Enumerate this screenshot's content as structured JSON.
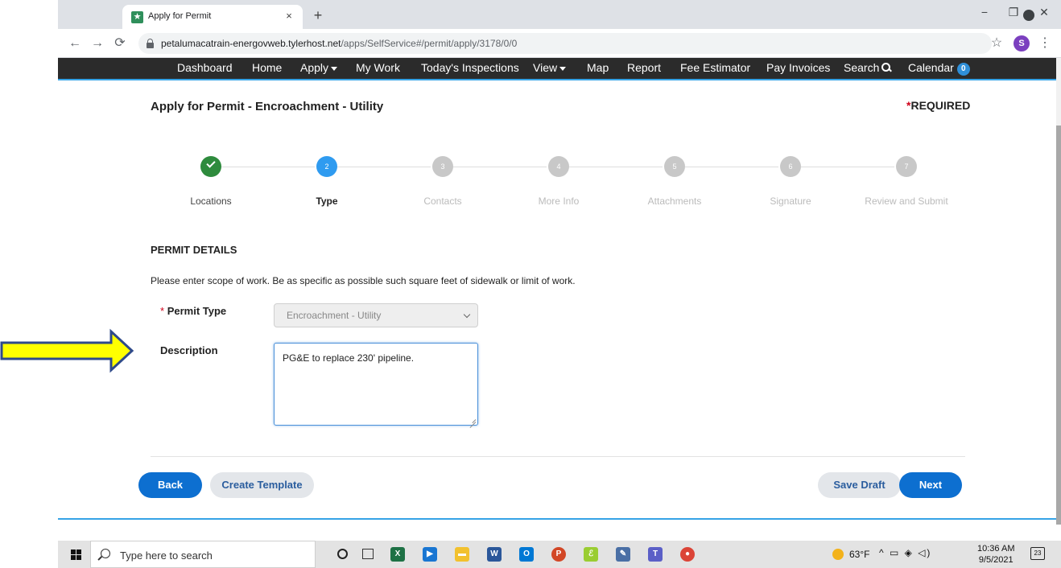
{
  "browser": {
    "tab_title": "Apply for Permit",
    "tab_close": "×",
    "new_tab": "+",
    "url_host": "petalumacatrain-energovweb.tylerhost.net",
    "url_path": "/apps/SelfService#/permit/apply/3178/0/0",
    "avatar_letter": "S",
    "window_controls": [
      "−",
      "❐",
      "✕"
    ]
  },
  "nav": {
    "items": [
      {
        "label": "Dashboard"
      },
      {
        "label": "Home"
      },
      {
        "label": "Apply",
        "dropdown": true
      },
      {
        "label": "My Work"
      },
      {
        "label": "Today's Inspections"
      },
      {
        "label": "View",
        "dropdown": true
      },
      {
        "label": "Map"
      },
      {
        "label": "Report"
      },
      {
        "label": "Fee Estimator"
      },
      {
        "label": "Pay Invoices"
      },
      {
        "label": "Search"
      },
      {
        "label": "Calendar",
        "badge": "0"
      }
    ]
  },
  "page": {
    "title": "Apply for Permit - Encroachment - Utility",
    "required_asterisk": "*",
    "required_text": "REQUIRED"
  },
  "steps": [
    {
      "number": "1",
      "label": "Locations",
      "state": "done"
    },
    {
      "number": "2",
      "label": "Type",
      "state": "active"
    },
    {
      "number": "3",
      "label": "Contacts",
      "state": "todo"
    },
    {
      "number": "4",
      "label": "More Info",
      "state": "todo"
    },
    {
      "number": "5",
      "label": "Attachments",
      "state": "todo"
    },
    {
      "number": "6",
      "label": "Signature",
      "state": "todo"
    },
    {
      "number": "7",
      "label": "Review and Submit",
      "state": "todo"
    }
  ],
  "form": {
    "section_header": "PERMIT DETAILS",
    "instructions": "Please enter scope of work. Be as specific as possible such square feet of sidewalk or limit of work.",
    "permit_type_required": "*",
    "permit_type_label": "Permit Type",
    "permit_type_value": "Encroachment - Utility",
    "description_label": "Description",
    "description_value": "PG&E to replace 230' pipeline."
  },
  "buttons": {
    "back": "Back",
    "create_template": "Create Template",
    "save_draft": "Save Draft",
    "next": "Next"
  },
  "taskbar": {
    "search_placeholder": "Type here to search",
    "temperature": "63°F",
    "time": "10:36 AM",
    "date": "9/5/2021",
    "notifications": "23"
  },
  "colors": {
    "nav_bg": "#2b2b2b",
    "accent_blue": "#36a3e6",
    "primary_button": "#0d6fd0",
    "step_done": "#2e8b3d",
    "step_active": "#2f9bf0",
    "annotation_arrow_fill": "#ffff00",
    "annotation_arrow_stroke": "#2f4a8a"
  }
}
